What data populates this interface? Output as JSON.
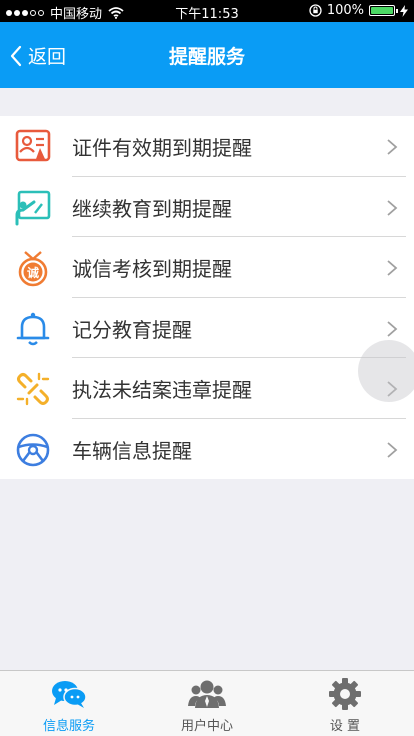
{
  "status_bar": {
    "carrier": "中国移动",
    "time": "下午11:53",
    "battery": "100%",
    "battery_level": 1.0
  },
  "nav": {
    "back_label": "返回",
    "title": "提醒服务"
  },
  "list_items": [
    {
      "label": "证件有效期到期提醒",
      "icon": "certificate-icon"
    },
    {
      "label": "继续教育到期提醒",
      "icon": "education-icon"
    },
    {
      "label": "诚信考核到期提醒",
      "icon": "integrity-badge-icon"
    },
    {
      "label": "记分教育提醒",
      "icon": "bell-icon"
    },
    {
      "label": "执法未结案违章提醒",
      "icon": "broken-link-icon"
    },
    {
      "label": "车辆信息提醒",
      "icon": "steering-wheel-icon"
    }
  ],
  "tab_bar": [
    {
      "label": "信息服务",
      "icon": "chat-bubbles-icon",
      "active": true
    },
    {
      "label": "用户中心",
      "icon": "users-icon",
      "active": false
    },
    {
      "label": "设 置",
      "icon": "gear-icon",
      "active": false
    }
  ],
  "colors": {
    "primary": "#0a9cf5",
    "background": "#efeff4"
  }
}
